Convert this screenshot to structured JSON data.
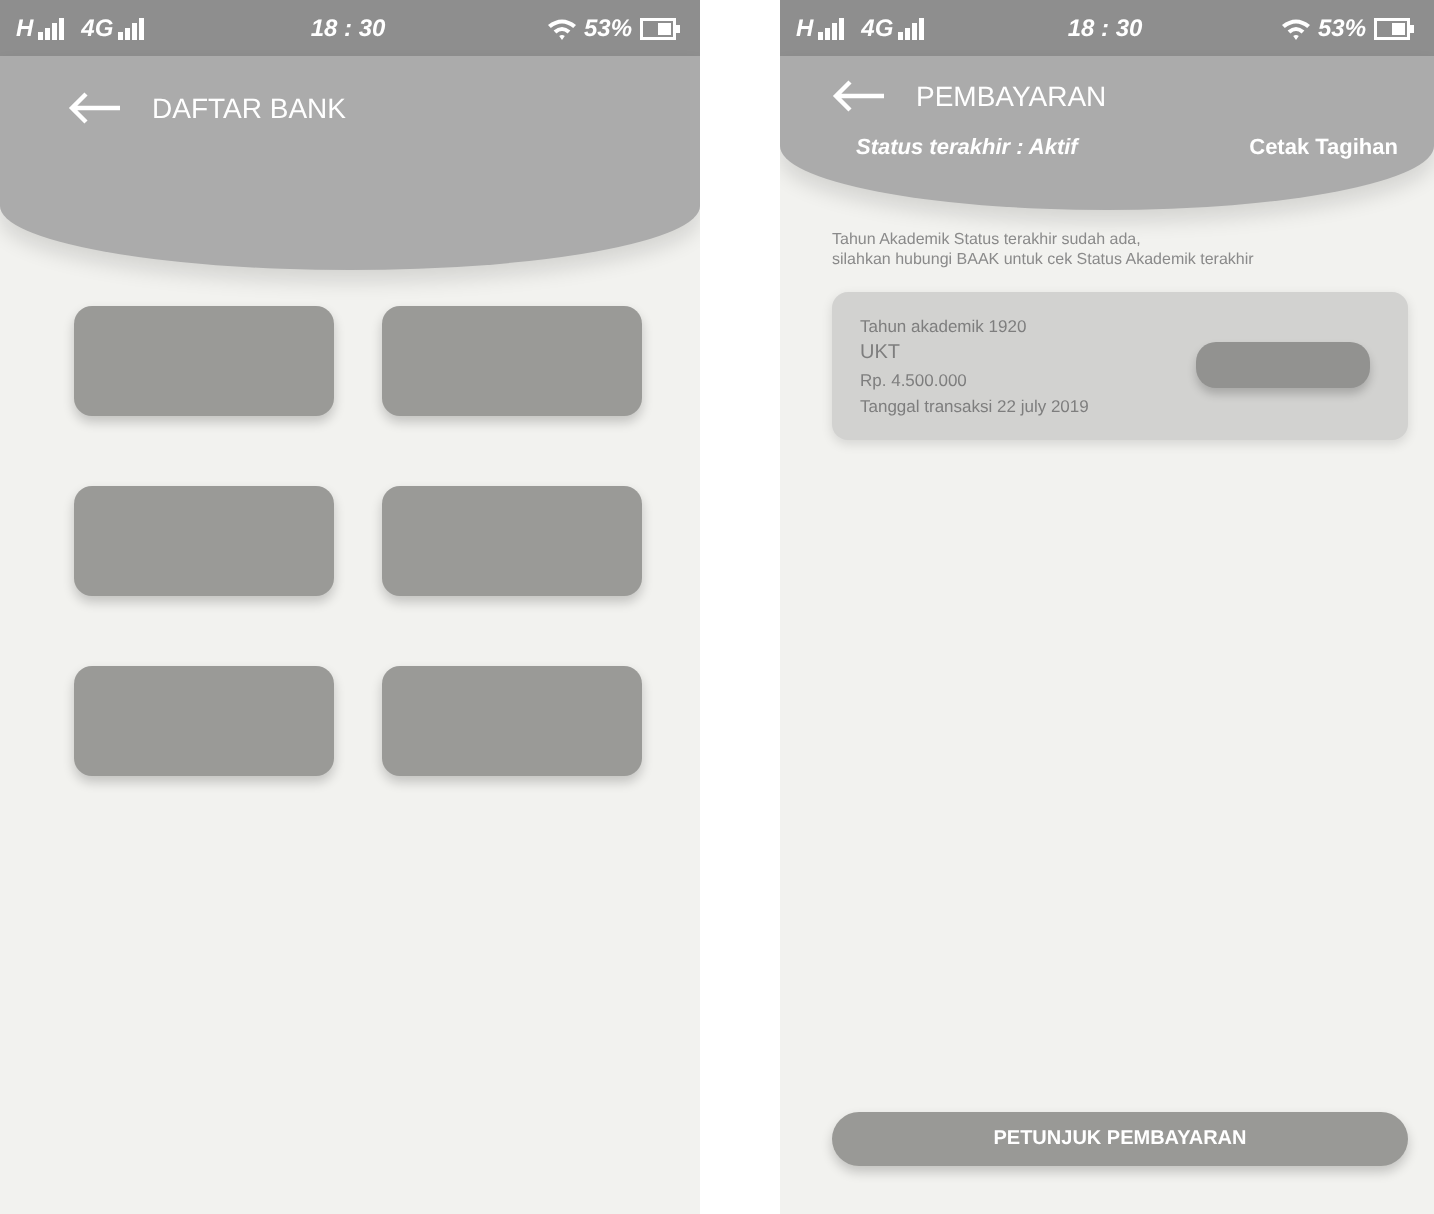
{
  "screens": [
    {
      "kind": "bank_list",
      "status_bar": {
        "network_1": "H",
        "network_2": "4G",
        "time": "18 : 30",
        "battery": "53%"
      },
      "header": {
        "title": "DAFTAR BANK"
      },
      "bank_tiles": [
        {
          "kind": "tile"
        },
        {
          "kind": "tile"
        },
        {
          "kind": "tile"
        },
        {
          "kind": "tile"
        },
        {
          "kind": "tile"
        },
        {
          "kind": "tile"
        }
      ]
    },
    {
      "kind": "payment",
      "status_bar": {
        "network_1": "H",
        "network_2": "4G",
        "time": "18 : 30",
        "battery": "53%"
      },
      "header": {
        "title": "PEMBAYARAN",
        "status": "Status terakhir : Aktif",
        "action": "Cetak Tagihan"
      },
      "notice": "Tahun Akademik Status terakhir sudah ada,\nsilahkan hubungi BAAK untuk cek Status Akademik terakhir",
      "bill": {
        "year": "Tahun akademik 1920",
        "type": "UKT",
        "amount": "Rp. 4.500.000",
        "date": "Tanggal transaksi 22 july 2019"
      },
      "footer_button": "PETUNJUK PEMBAYARAN"
    }
  ]
}
